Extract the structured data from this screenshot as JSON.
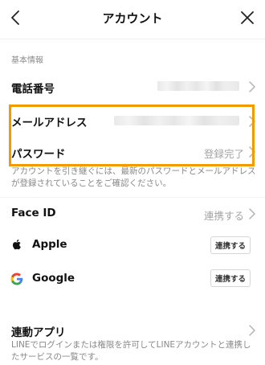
{
  "header": {
    "title": "アカウント",
    "back_icon": "chevron-left-icon",
    "close_icon": "close-x-icon"
  },
  "section": {
    "label": "基本情報"
  },
  "rows": {
    "phone": {
      "label": "電話番号",
      "value_blurred": true
    },
    "email": {
      "label": "メールアドレス",
      "value_blurred": true
    },
    "password": {
      "label": "パスワード",
      "value": "登録完了"
    }
  },
  "note": "アカウントを引き継ぐには、最新のパスワードとメールアドレスが登録されていることをご確認ください。",
  "face_id": {
    "label": "Face ID",
    "value": "連携する"
  },
  "apple": {
    "label": "Apple",
    "button": "連携する",
    "icon": "apple-logo-icon"
  },
  "google": {
    "label": "Google",
    "button": "連携する",
    "icon": "google-logo-icon"
  },
  "linked_apps": {
    "label": "連動アプリ",
    "description": "LINEでログインまたは権限を許可してLINEアカウントと連携したサービスの一覧です。"
  },
  "colors": {
    "highlight": "#f39a00",
    "muted_text": "#a3a3a3"
  }
}
